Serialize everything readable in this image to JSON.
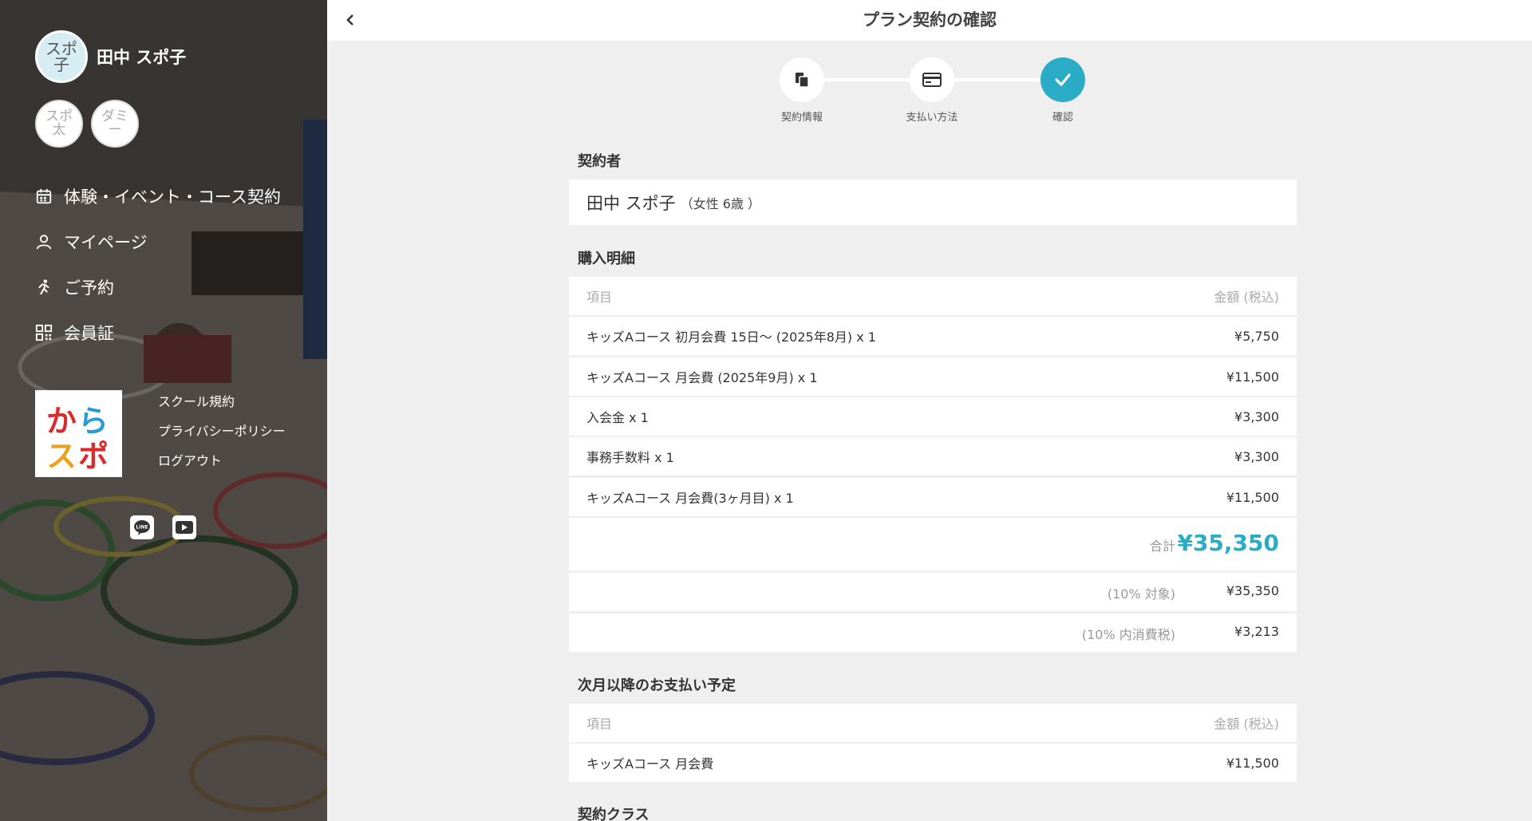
{
  "header": {
    "title": "プラン契約の確認"
  },
  "sidebar": {
    "user": {
      "avatar_text": "スポ子",
      "name": "田中 スポ子"
    },
    "members": [
      {
        "avatar_text": "スポ太"
      },
      {
        "avatar_text": "ダミー"
      }
    ],
    "nav": [
      {
        "label": "体験・イベント・コース契約",
        "icon": "calendar-icon"
      },
      {
        "label": "マイページ",
        "icon": "user-icon"
      },
      {
        "label": "ご予約",
        "icon": "runner-icon"
      },
      {
        "label": "会員証",
        "icon": "qr-icon"
      }
    ],
    "logo_text": "からスポ",
    "links": [
      "スクール規約",
      "プライバシーポリシー",
      "ログアウト"
    ],
    "social": [
      "line-icon",
      "youtube-icon"
    ]
  },
  "stepper": {
    "steps": [
      {
        "label": "契約情報",
        "icon": "document-icon"
      },
      {
        "label": "支払い方法",
        "icon": "credit-card-icon"
      },
      {
        "label": "確認",
        "icon": "check-icon"
      }
    ],
    "active_index": 2
  },
  "contractor": {
    "title": "契約者",
    "name": "田中 スポ子",
    "meta": "（女性 6歳 ）"
  },
  "purchase": {
    "title": "購入明細",
    "header": {
      "item": "項目",
      "amount": "金額 (税込)"
    },
    "rows": [
      {
        "item": "キッズAコース 初月会費 15日〜 (2025年8月) x 1",
        "amount": "¥5,750"
      },
      {
        "item": "キッズAコース 月会費 (2025年9月) x 1",
        "amount": "¥11,500"
      },
      {
        "item": "入会金 x 1",
        "amount": "¥3,300"
      },
      {
        "item": "事務手数料 x 1",
        "amount": "¥3,300"
      },
      {
        "item": "キッズAコース 月会費(3ヶ月目) x 1",
        "amount": "¥11,500"
      }
    ],
    "total_label": "合計",
    "total_value": "¥35,350",
    "tax_rows": [
      {
        "label": "(10% 対象)",
        "value": "¥35,350"
      },
      {
        "label": "(10% 内消費税)",
        "value": "¥3,213"
      }
    ]
  },
  "future": {
    "title": "次月以降のお支払い予定",
    "header": {
      "item": "項目",
      "amount": "金額 (税込)"
    },
    "rows": [
      {
        "item": "キッズAコース 月会費",
        "amount": "¥11,500"
      }
    ]
  },
  "contract_class": {
    "title": "契約クラス"
  },
  "colors": {
    "accent": "#2aabc6",
    "sidebar_bg": "#3a3634",
    "page_bg": "#efefef"
  }
}
